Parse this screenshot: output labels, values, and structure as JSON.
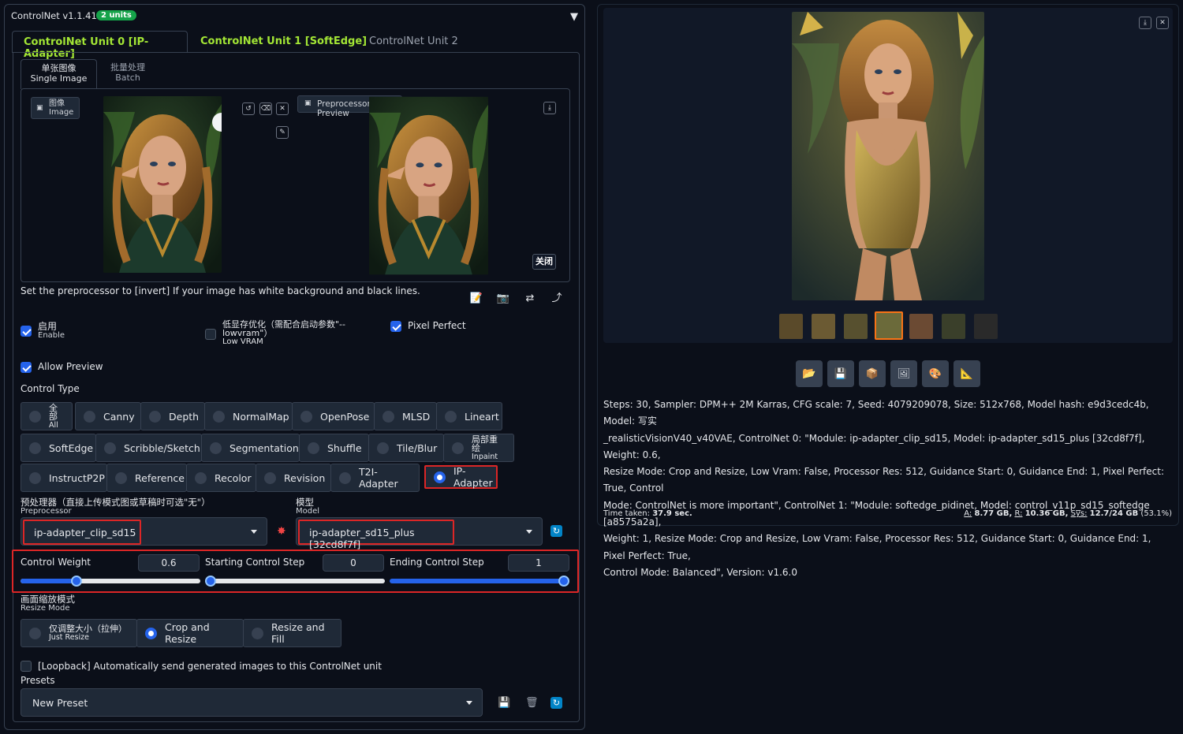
{
  "header": {
    "title": "ControlNet v1.1.410",
    "badge": "2 units"
  },
  "unit_tabs": [
    {
      "label": "ControlNet Unit 0 [IP-Adapter]"
    },
    {
      "label": "ControlNet Unit 1 [SoftEdge]"
    },
    {
      "label": "ControlNet Unit 2"
    }
  ],
  "mode_tabs": [
    {
      "cn": "单张图像",
      "en": "Single Image"
    },
    {
      "cn": "批量处理",
      "en": "Batch"
    }
  ],
  "image_panel": {
    "label_cn": "图像",
    "label_en": "Image",
    "preview_label": "Preprocessor Preview",
    "close_label": "关闭"
  },
  "note": "Set the preprocessor to [invert] If your image has white background and black lines.",
  "options": {
    "enable": {
      "cn": "启用",
      "en": "Enable",
      "checked": true
    },
    "low_vram": {
      "cn": "低显存优化（需配合启动参数\"--",
      "cn2": "lowvram\"）",
      "en": "Low VRAM",
      "checked": false
    },
    "pixel_perfect": {
      "label": "Pixel Perfect",
      "checked": true
    },
    "allow_preview": {
      "label": "Allow Preview",
      "checked": true
    }
  },
  "control_type": {
    "label": "Control Type",
    "items": [
      "Canny",
      "Depth",
      "NormalMap",
      "OpenPose",
      "MLSD",
      "Lineart",
      "SoftEdge",
      "Scribble/Sketch",
      "Segmentation",
      "Shuffle",
      "Tile/Blur",
      "InstructP2P",
      "Reference",
      "Recolor",
      "Revision",
      "T2I-Adapter",
      "IP-Adapter"
    ],
    "all_cn": "全部",
    "all_en": "All",
    "inpaint_cn": "局部重绘",
    "inpaint_en": "Inpaint",
    "selected": "IP-Adapter"
  },
  "preprocessor": {
    "label_cn": "预处理器（直接上传模式图或草稿时可选\"无\"）",
    "label_en": "Preprocessor",
    "value": "ip-adapter_clip_sd15"
  },
  "model": {
    "label_cn": "模型",
    "label_en": "Model",
    "value": "ip-adapter_sd15_plus [32cd8f7f]"
  },
  "sliders": {
    "weight": {
      "label": "Control Weight",
      "value": "0.6",
      "fraction": 0.3
    },
    "start": {
      "label": "Starting Control Step",
      "value": "0",
      "fraction": 0
    },
    "end": {
      "label": "Ending Control Step",
      "value": "1",
      "fraction": 1
    }
  },
  "resize_mode": {
    "label_cn": "画面缩放模式",
    "label_en": "Resize Mode",
    "just_cn": "仅调整大小（拉伸）",
    "just_en": "Just Resize",
    "crop": "Crop and Resize",
    "fill": "Resize and Fill",
    "selected": "Crop and Resize"
  },
  "loopback": "[Loopback] Automatically send generated images to this ControlNet unit",
  "presets": {
    "label": "Presets",
    "value": "New Preset"
  },
  "output": {
    "info_lines": [
      "Steps: 30, Sampler: DPM++ 2M Karras, CFG scale: 7, Seed: 4079209078, Size: 512x768, Model hash: e9d3cedc4b, Model: 写实",
      "_realisticVisionV40_v40VAE, ControlNet 0: \"Module: ip-adapter_clip_sd15, Model: ip-adapter_sd15_plus [32cd8f7f], Weight: 0.6,",
      "Resize Mode: Crop and Resize, Low Vram: False, Processor Res: 512, Guidance Start: 0, Guidance End: 1, Pixel Perfect: True, Control",
      "Mode: ControlNet is more important\", ControlNet 1: \"Module: softedge_pidinet, Model: control_v11p_sd15_softedge [a8575a2a],",
      "Weight: 1, Resize Mode: Crop and Resize, Low Vram: False, Processor Res: 512, Guidance Start: 0, Guidance End: 1, Pixel Perfect: True,",
      "Control Mode: Balanced\", Version: v1.6.0"
    ],
    "time_label": "Time taken:",
    "time_value": "37.9 sec.",
    "mem_a": "A:",
    "mem_a_v": "8.77 GB,",
    "mem_r": "R:",
    "mem_r_v": "10.36 GB,",
    "mem_s": "Sys:",
    "mem_s_v": "12.7/24 GB",
    "mem_pct": "(53.1%)"
  },
  "colors": {
    "accent": "#2563eb",
    "tab_green": "#a3e635",
    "highlight": "#dc2626",
    "bg": "#0b0f19"
  }
}
